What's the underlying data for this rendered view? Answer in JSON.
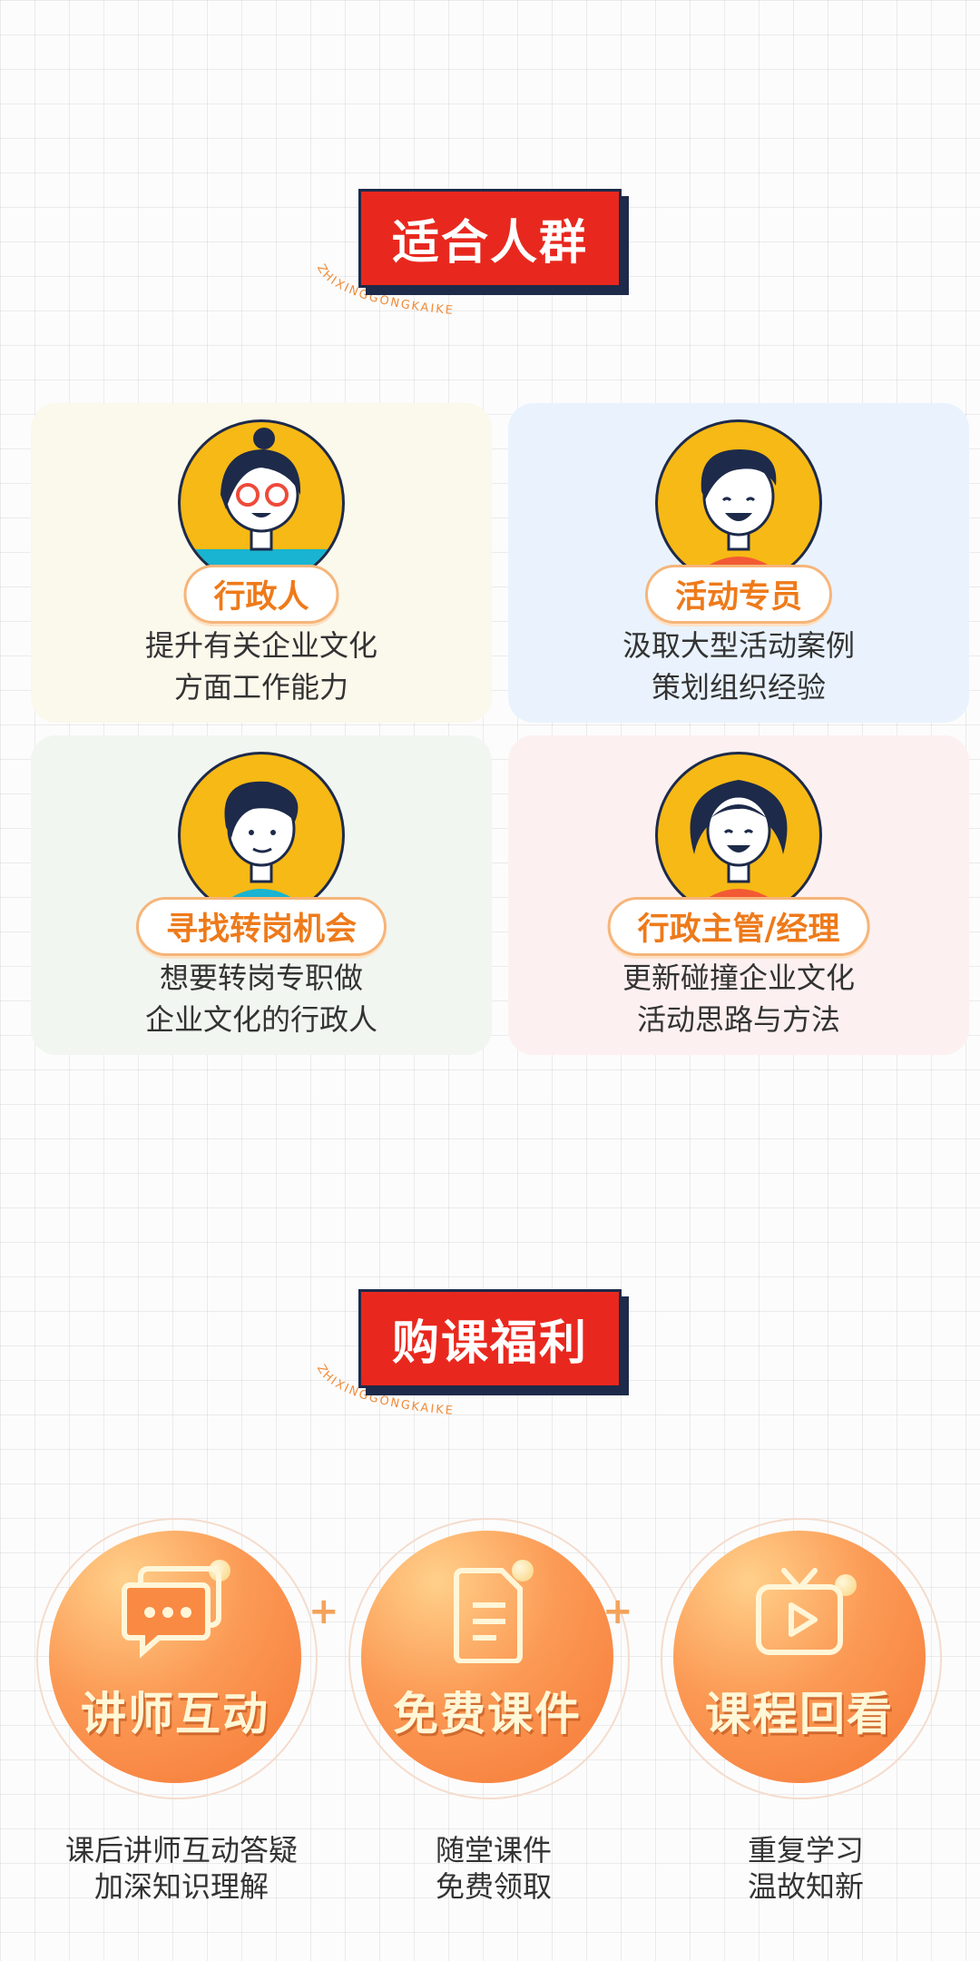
{
  "section1": {
    "title": "适合人群"
  },
  "section2": {
    "title": "购课福利"
  },
  "decorative_ring_text": "ZHIXINGGONGKAIKE",
  "audience": [
    {
      "role": "行政人",
      "desc": [
        "提升有关企业文化",
        "方面工作能力"
      ]
    },
    {
      "role": "活动专员",
      "desc": [
        "汲取大型活动案例",
        "策划组织经验"
      ]
    },
    {
      "role": "寻找转岗机会",
      "desc": [
        "想要转岗专职做",
        "企业文化的行政人"
      ]
    },
    {
      "role": "行政主管/经理",
      "desc": [
        "更新碰撞企业文化",
        "活动思路与方法"
      ]
    }
  ],
  "benefits": [
    {
      "title": "讲师互动",
      "icon": "chat-bubbles-icon",
      "desc": [
        "课后讲师互动答疑",
        "加深知识理解"
      ]
    },
    {
      "title": "免费课件",
      "icon": "document-icon",
      "desc": [
        "随堂课件",
        "免费领取"
      ]
    },
    {
      "title": "课程回看",
      "icon": "video-play-icon",
      "desc": [
        "重复学习",
        "温故知新"
      ]
    }
  ],
  "plus_sign": "+",
  "colors": {
    "title_red": "#e8281e",
    "title_shadow": "#1d2a4a",
    "pill_text": "#ee7a1a",
    "avatar_bg": "#f7b915",
    "card_bg_1": "#fbf8ec",
    "card_bg_2": "#eaf3fd",
    "card_bg_3": "#f1f6f1",
    "card_bg_4": "#fdf0f0"
  }
}
